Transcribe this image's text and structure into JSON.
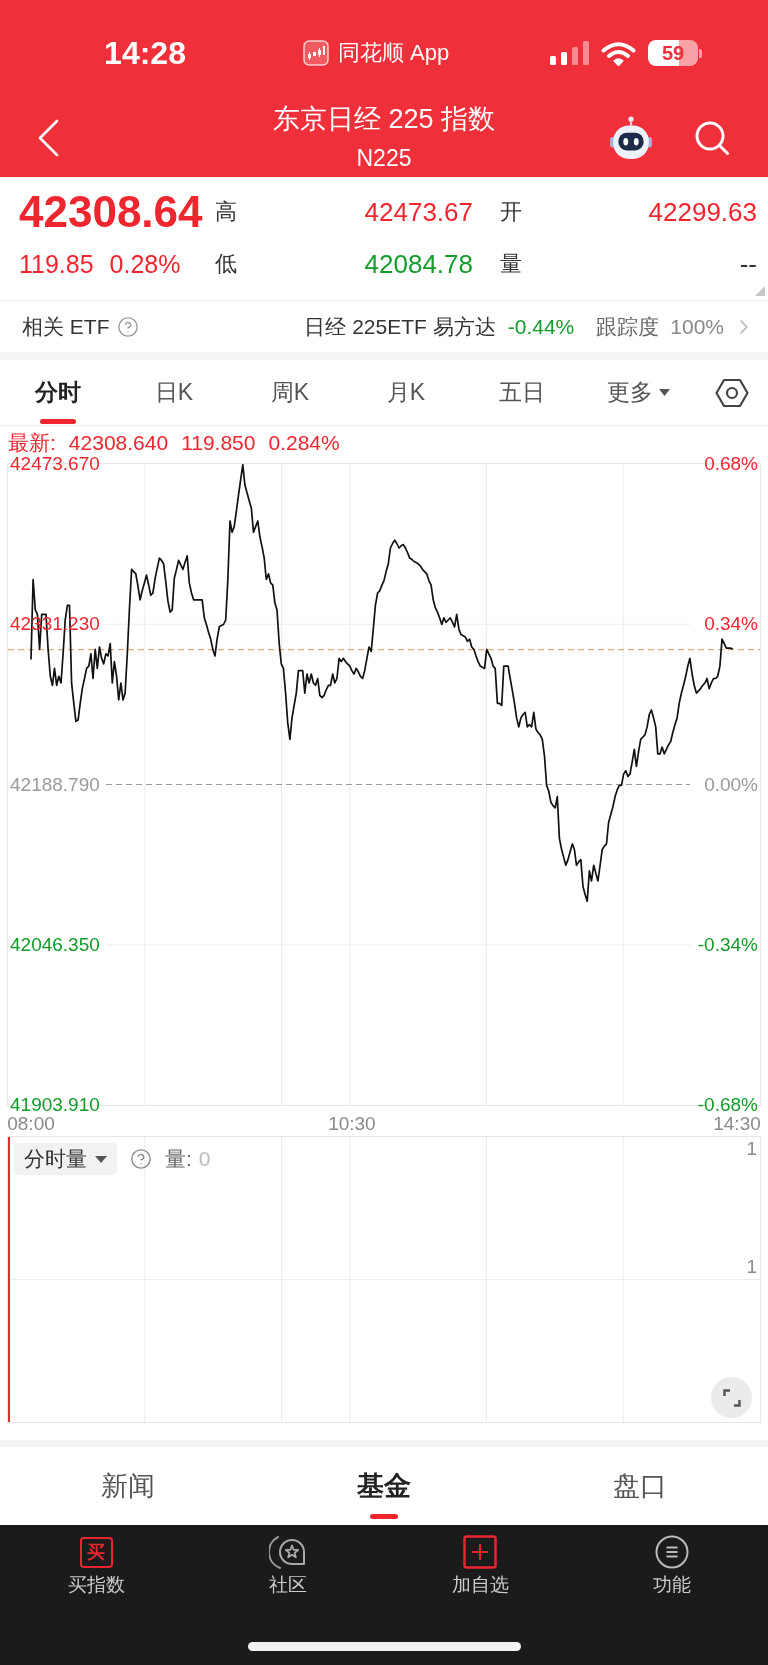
{
  "status_bar": {
    "time": "14:28",
    "app_name": "同花顺 App",
    "battery": "59"
  },
  "nav": {
    "title": "东京日经 225 指数",
    "subtitle": "N225"
  },
  "quote": {
    "price": "42308.64",
    "change": "119.85",
    "change_pct": "0.28%",
    "rising": true,
    "stats": [
      {
        "label": "高",
        "value": "42473.67",
        "color": "#f0262f"
      },
      {
        "label": "开",
        "value": "42299.63",
        "color": "#f0262f"
      },
      {
        "label": "低",
        "value": "42084.78",
        "color": "#129c2b"
      },
      {
        "label": "量",
        "value": "--",
        "color": "#333333"
      }
    ]
  },
  "etf": {
    "label": "相关 ETF",
    "fund_name": "日经 225ETF 易方达",
    "change": "-0.44%",
    "rising": false,
    "tracking_label": "跟踪度",
    "tracking_value": "100%"
  },
  "chart_tabs": [
    {
      "label": "分时",
      "selected": true,
      "kind": "tab"
    },
    {
      "label": "日K",
      "selected": false,
      "kind": "tab"
    },
    {
      "label": "周K",
      "selected": false,
      "kind": "tab"
    },
    {
      "label": "月K",
      "selected": false,
      "kind": "tab"
    },
    {
      "label": "五日",
      "selected": false,
      "kind": "tab"
    },
    {
      "label": "更多",
      "selected": false,
      "kind": "dropdown"
    }
  ],
  "latest": {
    "label": "最新:",
    "rising": true,
    "values": [
      "42308.640",
      "119.850",
      "0.284%"
    ]
  },
  "price_chart": {
    "right_axis": [
      "0.68%",
      "0.34%",
      "0.00%",
      "-0.34%",
      "-0.68%"
    ],
    "chart_data": {
      "type": "line",
      "ylim": [
        41903.91,
        42473.67
      ],
      "yticks": [
        {
          "value": 42473.67,
          "label": "42473.670"
        },
        {
          "value": 42331.23,
          "label": "42331.230"
        },
        {
          "value": 42188.79,
          "label": "42188.790"
        },
        {
          "value": 42046.35,
          "label": "42046.350"
        },
        {
          "value": 41903.91,
          "label": "41903.910"
        }
      ],
      "ref_lines": [
        {
          "axis": "y",
          "value": 42188.79,
          "color": "#9a9a9a"
        },
        {
          "axis": "y",
          "value": 42308.64,
          "color": "#e3b07c"
        }
      ],
      "categories": [
        "08:00",
        null,
        null,
        null,
        null,
        null,
        null,
        null,
        null,
        null,
        null,
        null,
        null,
        null,
        null,
        null,
        null,
        null,
        null,
        null,
        null,
        null,
        null,
        null,
        null,
        null,
        null,
        null,
        null,
        null,
        null,
        null,
        null,
        null,
        null,
        null,
        null,
        null,
        null,
        null,
        null,
        null,
        null,
        null,
        null,
        null,
        null,
        null,
        null,
        null,
        null,
        null,
        null,
        null,
        null,
        null,
        null,
        null,
        null,
        null,
        null,
        null,
        null,
        null,
        null,
        null,
        null,
        null,
        null,
        null,
        null,
        null,
        null,
        null,
        null,
        null,
        null,
        null,
        null,
        null,
        null,
        null,
        null,
        null,
        null,
        null,
        null,
        null,
        null,
        null,
        null,
        null,
        null,
        null,
        null,
        null,
        null,
        null,
        null,
        null,
        null,
        null,
        null,
        null,
        null,
        null,
        null,
        null,
        null,
        null,
        null,
        null,
        null,
        null,
        null,
        null,
        null,
        null,
        null,
        null,
        null,
        null,
        null,
        null,
        null,
        null,
        null,
        null,
        null,
        null,
        null,
        null,
        null,
        null,
        null,
        null,
        null,
        null,
        null,
        null,
        null,
        null,
        null,
        null,
        null,
        null,
        null,
        null,
        null,
        null,
        "10:30",
        null,
        null,
        null,
        null,
        null,
        null,
        null,
        null,
        null,
        null,
        null,
        null,
        null,
        null,
        null,
        null,
        null,
        null,
        null,
        null,
        null,
        null,
        null,
        null,
        null,
        null,
        null,
        null,
        null,
        null,
        null,
        null,
        null,
        null,
        null,
        null,
        null,
        null,
        null,
        null,
        null,
        null,
        null,
        null,
        null,
        null,
        null,
        null,
        null,
        null,
        null,
        null,
        null,
        null,
        null,
        null,
        null,
        null,
        null,
        null,
        null,
        null,
        null,
        null,
        null,
        null,
        null,
        null,
        null,
        null,
        null,
        null,
        null,
        null,
        null,
        null,
        null,
        null,
        null,
        null,
        null,
        null,
        null,
        null,
        null,
        null,
        null,
        null,
        null,
        null,
        null,
        null,
        null,
        null,
        null,
        null,
        null,
        null,
        null,
        null,
        null,
        null,
        null,
        null,
        null,
        null,
        null,
        null,
        null,
        null,
        null,
        null,
        null,
        null,
        null,
        null,
        null,
        null,
        null,
        null,
        null,
        null,
        null,
        null,
        null,
        null,
        null,
        null,
        null,
        null,
        null,
        null,
        null,
        null,
        null,
        null,
        null,
        null,
        null,
        null,
        null,
        null,
        null,
        null,
        null,
        null,
        null,
        null,
        null,
        null,
        null,
        null,
        null,
        null,
        null,
        null,
        null,
        null,
        null,
        null,
        null,
        null,
        null,
        null,
        null,
        null,
        null,
        null,
        null,
        null,
        null,
        null,
        null,
        null,
        null,
        null,
        null,
        null,
        null,
        "14:30"
      ],
      "values": [
        42300,
        42371,
        42344,
        42340,
        42309,
        42340,
        42340,
        42340,
        42309,
        42285,
        42277,
        42292,
        42277,
        42285,
        42279,
        42305,
        42335,
        42348,
        42348,
        42279,
        42261,
        42245,
        42246,
        42261,
        42274,
        42283,
        42292,
        42294,
        42305,
        42283,
        42309,
        42292,
        42311,
        42301,
        42296,
        42305,
        42303,
        42314,
        42279,
        42298,
        42285,
        42264,
        42279,
        42264,
        42270,
        42305,
        42344,
        42380,
        42378,
        42376,
        42365,
        42353,
        42361,
        42368,
        42375,
        42366,
        42357,
        42359,
        42372,
        42381,
        42390,
        42388,
        42385,
        42369,
        42352,
        42342,
        42344,
        42372,
        42380,
        42388,
        42384,
        42380,
        42386,
        42392,
        42368,
        42359,
        42353,
        42353,
        42353,
        42353,
        42353,
        42337,
        42331,
        42324,
        42318,
        42309,
        42303,
        42318,
        42329,
        42330,
        42331,
        42335,
        42370,
        42423,
        42413,
        42418,
        42432,
        42446,
        42460,
        42473,
        42455,
        42448,
        42441,
        42434,
        42413,
        42418,
        42423,
        42409,
        42400,
        42390,
        42371,
        42376,
        42368,
        42366,
        42350,
        42344,
        42314,
        42296,
        42292,
        42270,
        42244,
        42229,
        42248,
        42259,
        42270,
        42290,
        42290,
        42290,
        42270,
        42287,
        42279,
        42287,
        42279,
        42277,
        42283,
        42268,
        42266,
        42268,
        42273,
        42277,
        42277,
        42287,
        42279,
        42283,
        42301,
        42298,
        42301,
        42298,
        42296,
        42294,
        42290,
        42287,
        42292,
        42289,
        42285,
        42283,
        42290,
        42301,
        42311,
        42307,
        42327,
        42348,
        42359,
        42361,
        42366,
        42370,
        42378,
        42385,
        42399,
        42403,
        42406,
        42403,
        42399,
        42401,
        42402,
        42399,
        42395,
        42390,
        42389,
        42387,
        42386,
        42385,
        42383,
        42380,
        42378,
        42376,
        42370,
        42366,
        42353,
        42346,
        42342,
        42337,
        42331,
        42337,
        42333,
        42335,
        42337,
        42333,
        42329,
        42340,
        42327,
        42322,
        42321,
        42320,
        42316,
        42318,
        42311,
        42309,
        42303,
        42298,
        42294,
        42293,
        42292,
        42309,
        42305,
        42301,
        42294,
        42292,
        42261,
        42261,
        42259,
        42294,
        42294,
        42294,
        42283,
        42272,
        42261,
        42248,
        42240,
        42248,
        42251,
        42253,
        42240,
        42242,
        42240,
        42253,
        42238,
        42235,
        42233,
        42229,
        42214,
        42188,
        42183,
        42173,
        42170,
        42168,
        42178,
        42141,
        42131,
        42124,
        42117,
        42122,
        42129,
        42136,
        42131,
        42117,
        42120,
        42122,
        42098,
        42091,
        42085,
        42112,
        42103,
        42117,
        42110,
        42103,
        42117,
        42131,
        42134,
        42136,
        42155,
        42162,
        42169,
        42178,
        42184,
        42188,
        42188,
        42198,
        42201,
        42196,
        42198,
        42209,
        42220,
        42205,
        42218,
        42229,
        42231,
        42233,
        42240,
        42251,
        42255,
        42248,
        42240,
        42216,
        42216,
        42222,
        42216,
        42220,
        42224,
        42227,
        42235,
        42242,
        42248,
        42261,
        42270,
        42277,
        42285,
        42294,
        42301,
        42287,
        42277,
        42270,
        42272,
        42274,
        42277,
        42279,
        42283,
        42274,
        42279,
        42283,
        42283,
        42285,
        42294,
        42318,
        42314,
        42310,
        42310,
        42310,
        42309,
        null,
        null
      ]
    }
  },
  "volume": {
    "selector": "分时量",
    "reading_label": "量:",
    "reading_value": "0",
    "axis_labels": [
      "1",
      "1"
    ]
  },
  "bottom_tabs": [
    {
      "label": "新闻",
      "selected": false
    },
    {
      "label": "基金",
      "selected": true
    },
    {
      "label": "盘口",
      "selected": false
    }
  ],
  "bottom_nav": [
    {
      "label": "买指数",
      "kind": "buy",
      "icon_text": "买"
    },
    {
      "label": "社区",
      "kind": "community"
    },
    {
      "label": "加自选",
      "kind": "add"
    },
    {
      "label": "功能",
      "kind": "menu"
    }
  ]
}
